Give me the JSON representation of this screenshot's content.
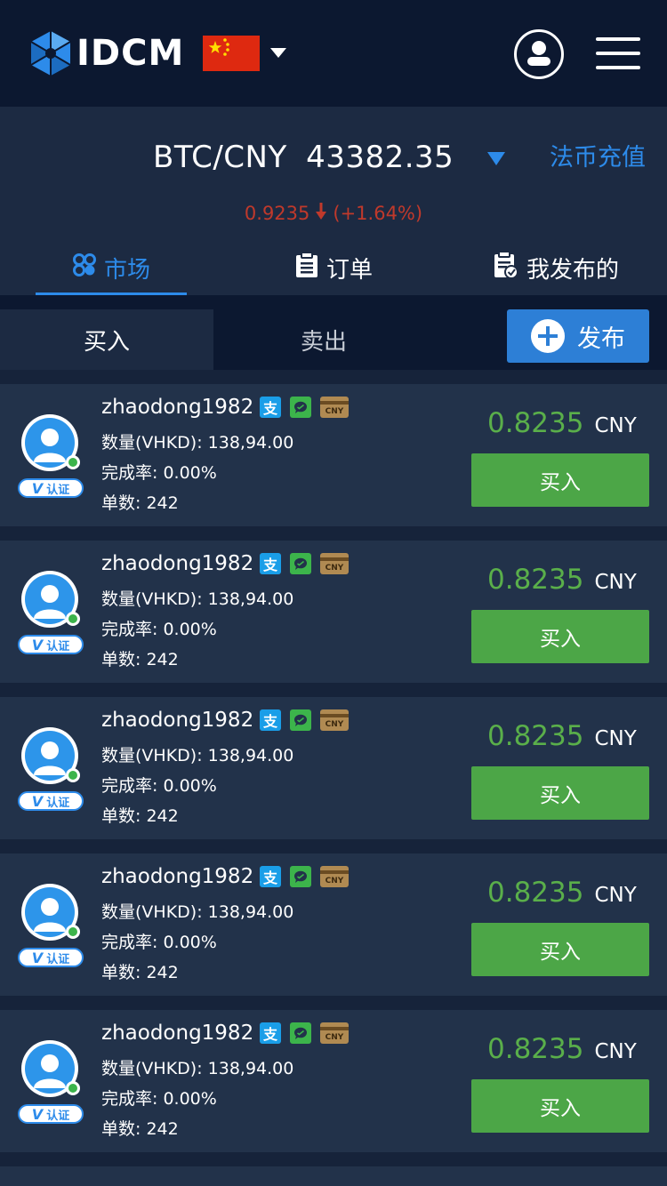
{
  "header": {
    "logo_text": "IDCM",
    "flag": "china-flag-icon"
  },
  "ticker": {
    "pair": "BTC/CNY",
    "price": "43382.35",
    "recharge_label": "法币充值",
    "change_value": "0.9235",
    "change_percent": "(+1.64%)",
    "change_color": "#c0392b"
  },
  "tabs": [
    {
      "label": "市场",
      "icon": "market-icon",
      "active": true
    },
    {
      "label": "订单",
      "icon": "order-clipboard-icon",
      "active": false
    },
    {
      "label": "我发布的",
      "icon": "my-posts-icon",
      "active": false
    }
  ],
  "trade_tabs": {
    "buy": "买入",
    "sell": "卖出",
    "publish": "发布"
  },
  "listing_labels": {
    "amount_prefix": "数量(VHKD): ",
    "rate_prefix": "完成率: ",
    "count_prefix": "单数: ",
    "verified": "认证",
    "card_text": "CNY"
  },
  "listings": [
    {
      "username": "zhaodong1982",
      "amount": "138,94.00",
      "rate": "0.00%",
      "count": "242",
      "price": "0.8235",
      "currency": "CNY",
      "action": "买入"
    },
    {
      "username": "zhaodong1982",
      "amount": "138,94.00",
      "rate": "0.00%",
      "count": "242",
      "price": "0.8235",
      "currency": "CNY",
      "action": "买入"
    },
    {
      "username": "zhaodong1982",
      "amount": "138,94.00",
      "rate": "0.00%",
      "count": "242",
      "price": "0.8235",
      "currency": "CNY",
      "action": "买入"
    },
    {
      "username": "zhaodong1982",
      "amount": "138,94.00",
      "rate": "0.00%",
      "count": "242",
      "price": "0.8235",
      "currency": "CNY",
      "action": "买入"
    },
    {
      "username": "zhaodong1982",
      "amount": "138,94.00",
      "rate": "0.00%",
      "count": "242",
      "price": "0.8235",
      "currency": "CNY",
      "action": "买入"
    }
  ],
  "colors": {
    "accent_blue": "#2d8bea",
    "buy_green": "#4ca647",
    "price_green": "#5aaf4a",
    "header_bg": "#0c1830",
    "card_bg": "#22324a"
  }
}
